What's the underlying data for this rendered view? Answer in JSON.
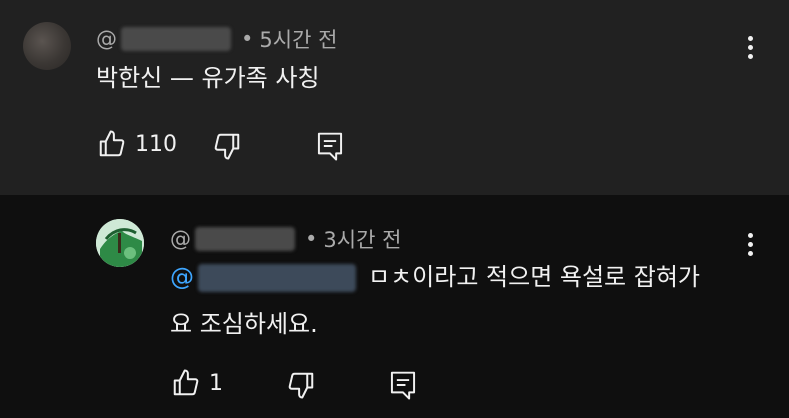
{
  "comment": {
    "handle_prefix": "@",
    "separator": "•",
    "time": "5시간 전",
    "text": "박한신 — 유가족 사칭",
    "like_count": "110"
  },
  "reply": {
    "handle_prefix": "@",
    "separator": "•",
    "time": "3시간 전",
    "mention_prefix": "@",
    "text_line1": "ㅁㅊ이라고 적으면 욕설로 잡혀가",
    "text_line2": "요 조심하세요.",
    "like_count": "1"
  },
  "icons": [
    "thumbs-up-icon",
    "thumbs-down-icon",
    "reply-icon",
    "more-vert-icon"
  ]
}
